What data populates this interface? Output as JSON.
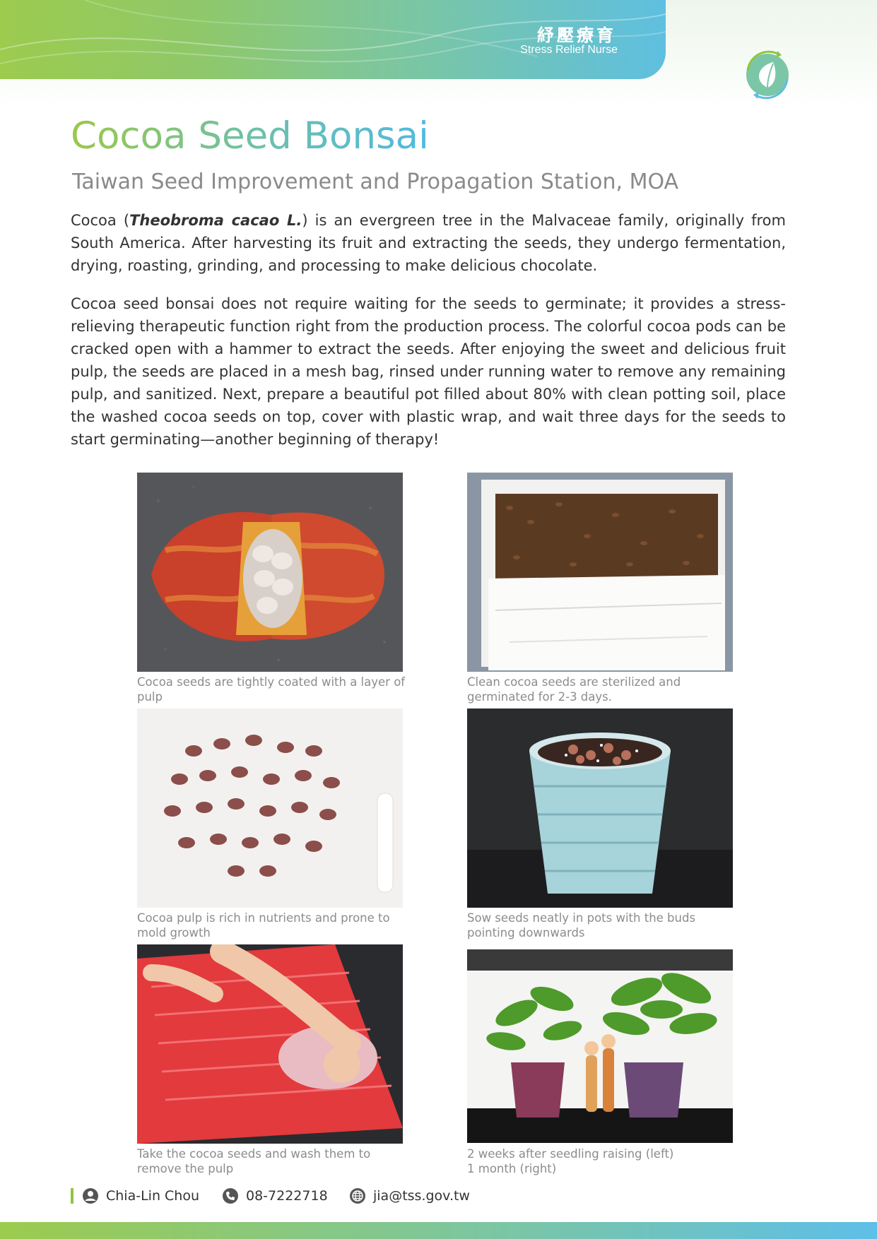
{
  "brand": {
    "name_zh": "紓壓療育",
    "name_en": "Stress Relief Nurse"
  },
  "colors": {
    "accent_green": "#8dc63f",
    "accent_blue": "#4fb9e2",
    "caption_gray": "#8c8c8c"
  },
  "title": "Cocoa Seed Bonsai",
  "subtitle": "Taiwan Seed Improvement and Propagation Station, MOA",
  "intro": {
    "lead": "Cocoa (",
    "species": "Theobroma cacao L.",
    "rest": ") is an evergreen tree in the Malvaceae family, originally from South America. After harvesting its fruit and extracting the seeds, they undergo fermentation, drying, roasting, grinding, and processing to make delicious chocolate."
  },
  "body": "Cocoa seed bonsai does not require waiting for the seeds to germinate; it provides a stress-relieving therapeutic function right from the production process. The colorful cocoa pods can be cracked open with a hammer to extract the seeds. After enjoying the sweet and delicious fruit pulp, the seeds are placed in a mesh bag, rinsed under running water to remove any remaining pulp, and sanitized. Next, prepare a beautiful pot filled about 80% with clean potting soil, place the washed cocoa seeds on top, cover with plastic wrap, and wait three days for the seeds to start germinating—another beginning of therapy!",
  "captions": {
    "c1": "Cocoa seeds are tightly coated with a layer of pulp",
    "c2": "Clean cocoa seeds are sterilized and germinated for 2-3 days.",
    "c3": "Cocoa pulp is rich in nutrients and prone to mold growth",
    "c4": "Sow seeds neatly in pots with the buds pointing downwards",
    "c5": "Take the cocoa seeds and wash them to remove the pulp",
    "c6_line1": "2 weeks after seedling raising (left)",
    "c6_line2": "1 month (right)"
  },
  "photo_icons": {
    "p1": "cocoa-pod-photo",
    "p2": "seed-tray-photo",
    "p3": "moldy-seeds-photo",
    "p4": "seed-pot-photo",
    "p5": "washing-seeds-photo",
    "p6": "seedlings-photo"
  },
  "contact": {
    "name": "Chia-Lin Chou",
    "phone": "08-7222718",
    "email": "jia@tss.gov.tw"
  }
}
